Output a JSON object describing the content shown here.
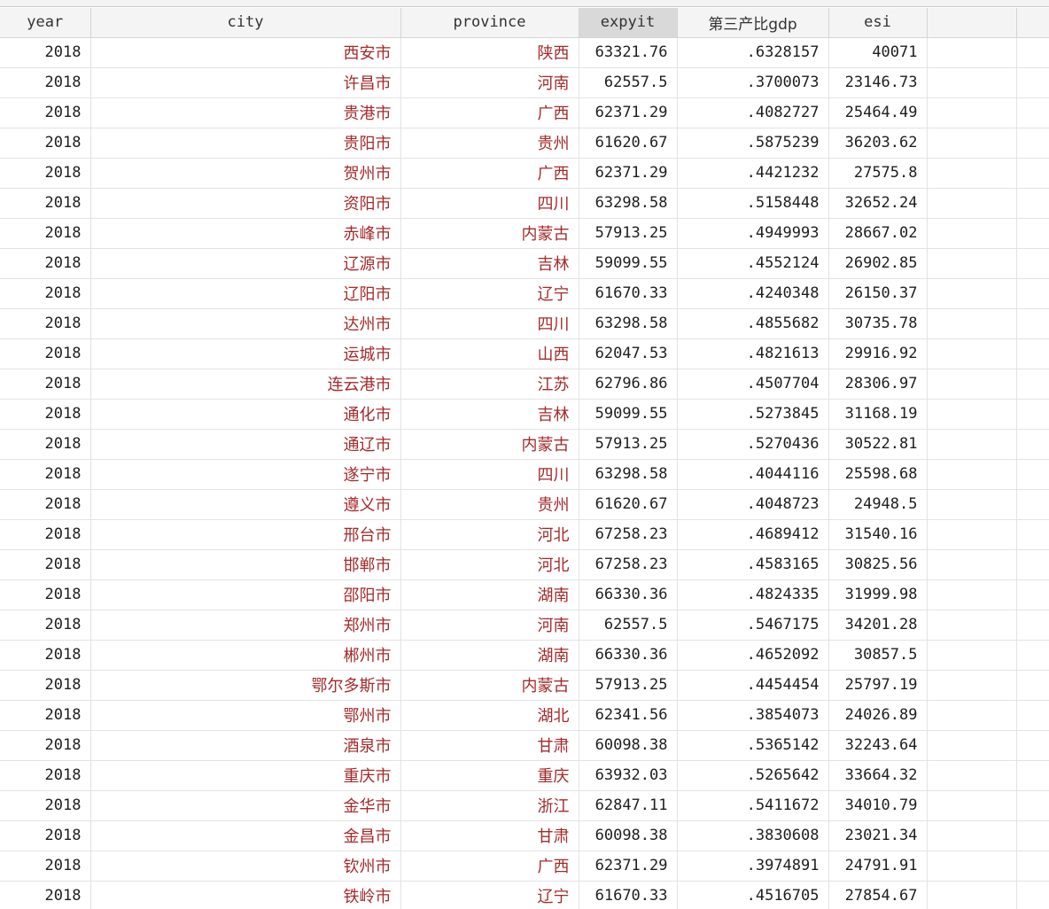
{
  "columns": [
    "year",
    "city",
    "province",
    "expyit",
    "第三产比gdp",
    "esi"
  ],
  "selected_column": "expyit",
  "rows": [
    [
      "2018",
      "西安市",
      "陕西",
      "63321.76",
      ".6328157",
      "40071"
    ],
    [
      "2018",
      "许昌市",
      "河南",
      "62557.5",
      ".3700073",
      "23146.73"
    ],
    [
      "2018",
      "贵港市",
      "广西",
      "62371.29",
      ".4082727",
      "25464.49"
    ],
    [
      "2018",
      "贵阳市",
      "贵州",
      "61620.67",
      ".5875239",
      "36203.62"
    ],
    [
      "2018",
      "贺州市",
      "广西",
      "62371.29",
      ".4421232",
      "27575.8"
    ],
    [
      "2018",
      "资阳市",
      "四川",
      "63298.58",
      ".5158448",
      "32652.24"
    ],
    [
      "2018",
      "赤峰市",
      "内蒙古",
      "57913.25",
      ".4949993",
      "28667.02"
    ],
    [
      "2018",
      "辽源市",
      "吉林",
      "59099.55",
      ".4552124",
      "26902.85"
    ],
    [
      "2018",
      "辽阳市",
      "辽宁",
      "61670.33",
      ".4240348",
      "26150.37"
    ],
    [
      "2018",
      "达州市",
      "四川",
      "63298.58",
      ".4855682",
      "30735.78"
    ],
    [
      "2018",
      "运城市",
      "山西",
      "62047.53",
      ".4821613",
      "29916.92"
    ],
    [
      "2018",
      "连云港市",
      "江苏",
      "62796.86",
      ".4507704",
      "28306.97"
    ],
    [
      "2018",
      "通化市",
      "吉林",
      "59099.55",
      ".5273845",
      "31168.19"
    ],
    [
      "2018",
      "通辽市",
      "内蒙古",
      "57913.25",
      ".5270436",
      "30522.81"
    ],
    [
      "2018",
      "遂宁市",
      "四川",
      "63298.58",
      ".4044116",
      "25598.68"
    ],
    [
      "2018",
      "遵义市",
      "贵州",
      "61620.67",
      ".4048723",
      "24948.5"
    ],
    [
      "2018",
      "邢台市",
      "河北",
      "67258.23",
      ".4689412",
      "31540.16"
    ],
    [
      "2018",
      "邯郸市",
      "河北",
      "67258.23",
      ".4583165",
      "30825.56"
    ],
    [
      "2018",
      "邵阳市",
      "湖南",
      "66330.36",
      ".4824335",
      "31999.98"
    ],
    [
      "2018",
      "郑州市",
      "河南",
      "62557.5",
      ".5467175",
      "34201.28"
    ],
    [
      "2018",
      "郴州市",
      "湖南",
      "66330.36",
      ".4652092",
      "30857.5"
    ],
    [
      "2018",
      "鄂尔多斯市",
      "内蒙古",
      "57913.25",
      ".4454454",
      "25797.19"
    ],
    [
      "2018",
      "鄂州市",
      "湖北",
      "62341.56",
      ".3854073",
      "24026.89"
    ],
    [
      "2018",
      "酒泉市",
      "甘肃",
      "60098.38",
      ".5365142",
      "32243.64"
    ],
    [
      "2018",
      "重庆市",
      "重庆",
      "63932.03",
      ".5265642",
      "33664.32"
    ],
    [
      "2018",
      "金华市",
      "浙江",
      "62847.11",
      ".5411672",
      "34010.79"
    ],
    [
      "2018",
      "金昌市",
      "甘肃",
      "60098.38",
      ".3830608",
      "23021.34"
    ],
    [
      "2018",
      "钦州市",
      "广西",
      "62371.29",
      ".3974891",
      "24791.91"
    ],
    [
      "2018",
      "铁岭市",
      "辽宁",
      "61670.33",
      ".4516705",
      "27854.67"
    ]
  ]
}
